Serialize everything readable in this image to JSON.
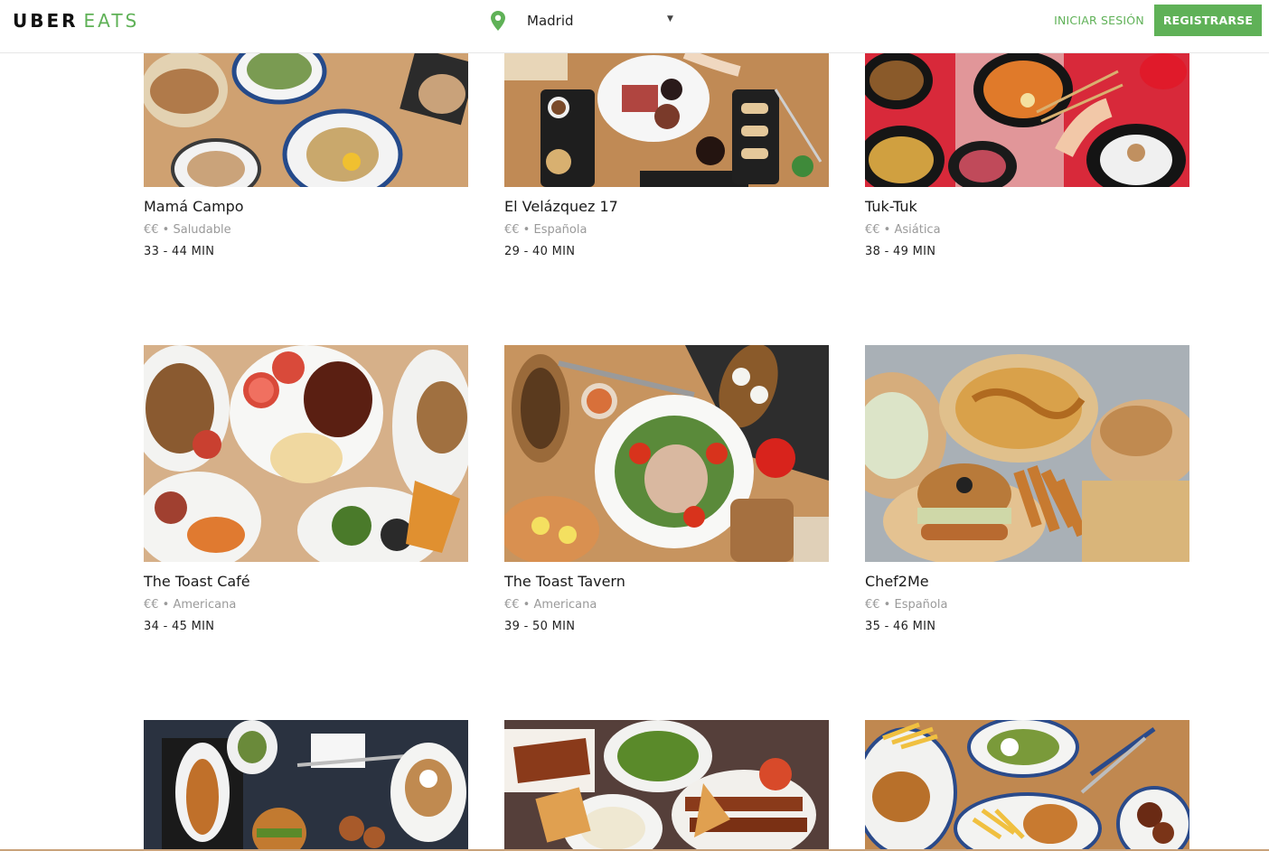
{
  "header": {
    "logo_uber": "UBER",
    "logo_eats": "EATS",
    "location": "Madrid",
    "location_icon": "map-pin-icon",
    "caret_icon": "caret-down-icon",
    "signin_label": "INICIAR SESIÓN",
    "register_label": "REGISTRARSE"
  },
  "colors": {
    "brand_green": "#5fb157",
    "text_dark": "#1a1a1a",
    "text_muted": "#9a9a9a"
  },
  "restaurants": [
    {
      "name": "Mamá Campo",
      "meta": "€€ • Saludable",
      "time": "33 - 44 MIN"
    },
    {
      "name": "El Velázquez 17",
      "meta": "€€ • Española",
      "time": "29 - 40 MIN"
    },
    {
      "name": "Tuk-Tuk",
      "meta": "€€ • Asiática",
      "time": "38 - 49 MIN"
    },
    {
      "name": "The Toast Café",
      "meta": "€€ • Americana",
      "time": "34 - 45 MIN"
    },
    {
      "name": "The Toast Tavern",
      "meta": "€€ • Americana",
      "time": "39 - 50 MIN"
    },
    {
      "name": "Chef2Me",
      "meta": "€€ • Española",
      "time": "35 - 46 MIN"
    },
    {
      "name": "",
      "meta": "",
      "time": ""
    },
    {
      "name": "",
      "meta": "",
      "time": ""
    },
    {
      "name": "",
      "meta": "",
      "time": ""
    }
  ]
}
